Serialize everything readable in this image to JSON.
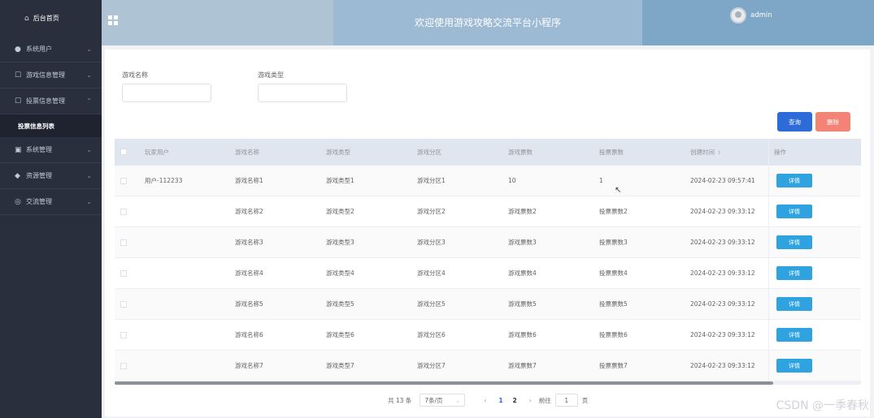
{
  "sidebar": {
    "home": "后台首页",
    "items": [
      {
        "label": "系统用户",
        "icon": "user-icon"
      },
      {
        "label": "游戏信息管理",
        "icon": "edit-icon"
      },
      {
        "label": "投票信息管理",
        "icon": "edit-icon"
      },
      {
        "label": "系统管理",
        "icon": "image-icon"
      },
      {
        "label": "资源管理",
        "icon": "location-icon"
      },
      {
        "label": "交流管理",
        "icon": "chat-icon"
      }
    ],
    "sub_active": "投票信息列表"
  },
  "header": {
    "title": "欢迎使用游戏攻略交流平台小程序",
    "user": "admin"
  },
  "search": {
    "name_label": "游戏名称",
    "type_label": "游戏类型",
    "query_label": "查询",
    "delete_label": "删除"
  },
  "table": {
    "columns": [
      "玩家用户",
      "游戏名称",
      "游戏类型",
      "游戏分区",
      "游戏票数",
      "投票票数",
      "创建时间",
      "操作"
    ],
    "detail_label": "详情",
    "rows": [
      [
        "用户-112233",
        "游戏名称1",
        "游戏类型1",
        "游戏分区1",
        "10",
        "1",
        "2024-02-23 09:57:41"
      ],
      [
        "",
        "游戏名称2",
        "游戏类型2",
        "游戏分区2",
        "游戏票数2",
        "投票票数2",
        "2024-02-23 09:33:12"
      ],
      [
        "",
        "游戏名称3",
        "游戏类型3",
        "游戏分区3",
        "游戏票数3",
        "投票票数3",
        "2024-02-23 09:33:12"
      ],
      [
        "",
        "游戏名称4",
        "游戏类型4",
        "游戏分区4",
        "游戏票数4",
        "投票票数4",
        "2024-02-23 09:33:12"
      ],
      [
        "",
        "游戏名称5",
        "游戏类型5",
        "游戏分区5",
        "游戏票数5",
        "投票票数5",
        "2024-02-23 09:33:12"
      ],
      [
        "",
        "游戏名称6",
        "游戏类型6",
        "游戏分区6",
        "游戏票数6",
        "投票票数6",
        "2024-02-23 09:33:12"
      ],
      [
        "",
        "游戏名称7",
        "游戏类型7",
        "游戏分区7",
        "游戏票数7",
        "投票票数7",
        "2024-02-23 09:33:12"
      ]
    ]
  },
  "pagination": {
    "total": "共 13 条",
    "page_size": "7条/页",
    "pages": [
      "1",
      "2"
    ],
    "current_page": "1",
    "goto_label": "前往",
    "goto_value": "1",
    "page_unit": "页"
  },
  "watermark": "CSDN @一季春秋",
  "colors": {
    "sidebar_bg": "#2a2f3d",
    "query_button": "#2d6bd8",
    "delete_button": "#f38475",
    "detail_button": "#2ea3e0"
  }
}
